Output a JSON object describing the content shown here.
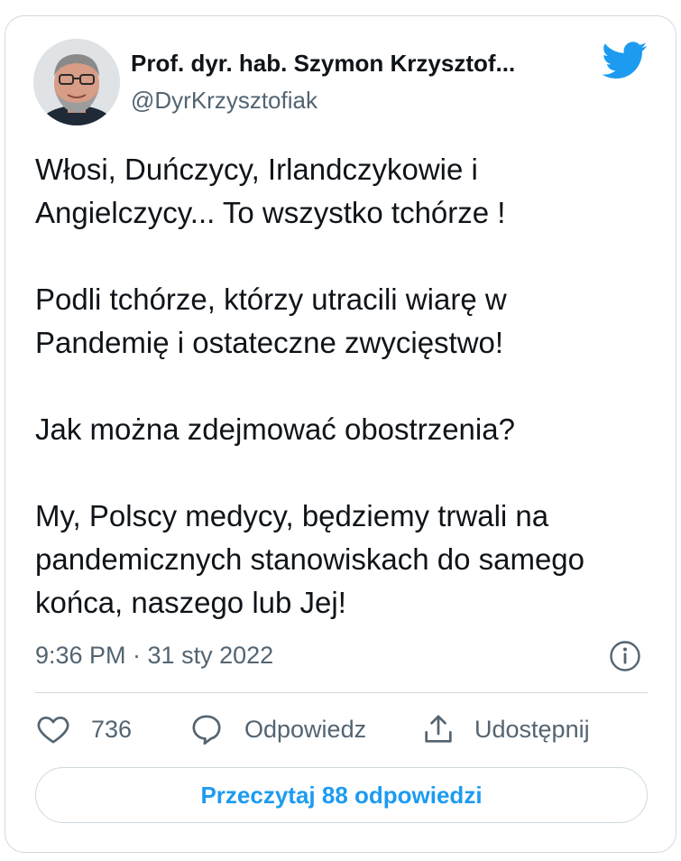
{
  "author": {
    "display_name": "Prof. dyr. hab. Szymon Krzysztof...",
    "handle": "@DyrKrzysztofiak"
  },
  "tweet": {
    "paragraphs": [
      "Włosi, Duńczycy, Irlandczykowie i Angielczycy... To wszystko tchórze !",
      "Podli tchórze, którzy utracili wiarę w Pandemię i ostateczne zwycięstwo!",
      "Jak można zdejmować obostrzenia?",
      "My, Polscy medycy, będziemy trwali na pandemicznych stanowiskach do samego końca, naszego lub Jej!"
    ],
    "timestamp": "9:36 PM · 31 sty 2022"
  },
  "actions": {
    "like_count": "736",
    "reply_label": "Odpowiedz",
    "share_label": "Udostępnij"
  },
  "read_replies_label": "Przeczytaj 88 odpowiedzi",
  "colors": {
    "twitter_blue": "#1d9bf0",
    "secondary_text": "#536471",
    "border": "#cfd9de"
  },
  "icons": [
    "avatar",
    "twitter-bird-icon",
    "info-icon",
    "heart-icon",
    "reply-icon",
    "share-icon"
  ]
}
